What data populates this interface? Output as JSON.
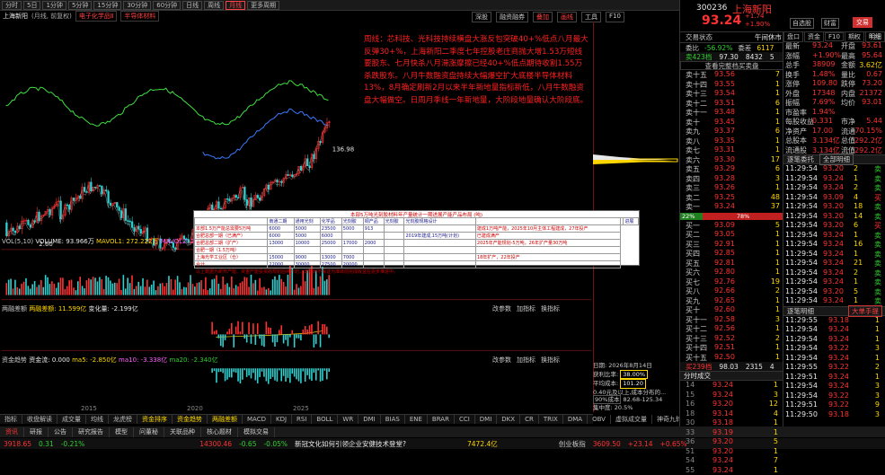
{
  "toolbar": {
    "periods": [
      "分时",
      "5日",
      "1分钟",
      "5分钟",
      "15分钟",
      "30分钟",
      "60分钟",
      "日线",
      "周线",
      "月线",
      "更多周期"
    ],
    "active_period": "月线",
    "right_buttons": [
      "深股",
      "融资融券",
      "叠加",
      "画线",
      "工具",
      "F10"
    ]
  },
  "titlebar": {
    "name": "上海新阳",
    "mode": "(月线, 前复权)",
    "tabs": [
      "电子化学品Ⅱ",
      "半导体材料"
    ]
  },
  "chart_tools": [
    "深股",
    "融资融券",
    "叠加",
    "画线",
    "工具"
  ],
  "price_labels": {
    "high": "136.98",
    "low": "2.60"
  },
  "annotation": "周线：芯科技、光科技持续横盘大涨反包突破40+%低点八月最大反弹30+%，上海新阳二季度七年控股老庄商抛大增1.53万短线要股东、七月快杀八月滞涨摩擦已经40+%低点期待收割1.55万杀跌股东。八月牛数融资盘持续大幅爆空扩大底楼半导体材料13%，8月确定刷新2月以来半年新地量指标新低，八月牛数融资盘大幅做空。日周月季线一年新地量，大阶段地量确认大阶段底。",
  "table_popup": {
    "title": "本部5万吨光刻胶材料年产量统计一期进展产能产品布局 (吨)",
    "headers": [
      "",
      "南通二期",
      "通用光刻",
      "化学品",
      "光刻胶",
      "铜产品",
      "光刻胶",
      "光刻胶规格设计",
      "",
      "",
      "进展"
    ],
    "rows": [
      [
        "本部1.5万产能总需要5万吨",
        "6000",
        "5000",
        "23500",
        "5000",
        "913",
        "",
        "",
        "建成1万吨产能，2025年10月主体工程建成，27年投产"
      ],
      [
        "合肥总部一期（已满产）",
        "6000",
        "5000",
        "6000",
        "",
        "",
        "",
        "2019年建成,15万吨(计划)",
        "已建成满产"
      ],
      [
        "合肥总部二期（扩产）",
        "13000",
        "10000",
        "25000",
        "17000",
        "2000",
        "",
        "",
        "2025年产能规划-5万吨，26年扩产量30万吨"
      ],
      [
        "合肥一期（1.5万吨）",
        "",
        "",
        "",
        "",
        "",
        "",
        "",
        ""
      ],
      [
        "上海光学工业区（仓）",
        "15000",
        "9000",
        "13000",
        "7000",
        "",
        "",
        "",
        "18年扩产，22年投产"
      ],
      [
        "合计",
        "22000",
        "30000",
        "27500",
        "20000",
        "",
        "",
        "",
        ""
      ]
    ],
    "note": "以上数据为新开产能、资金产能投资的规划后续计划，该规划不保证为准目前完成收益在逐步推进中。"
  },
  "indicators": {
    "vol": {
      "label": "VOL(5,10)",
      "volume": "VOLUME: 93.966万",
      "ma5": "MAVOL1: 272.222万",
      "ma10": "MAVOL2: 270.409万"
    },
    "margin": {
      "label": "两融差额",
      "value": "两融差额: 11.599亿",
      "change": "变化量: -2.199亿",
      "buttons": [
        "改参数",
        "加指标",
        "换指标"
      ]
    },
    "fund": {
      "label": "资金趋势",
      "value": "资金流: 0.000",
      "ma5": "ma5: -2.850亿",
      "ma10": "ma10: -3.338亿",
      "ma20": "ma20: -2.340亿",
      "buttons": [
        "改参数",
        "加指标",
        "换指标"
      ]
    }
  },
  "years": [
    "2015",
    "2020",
    "2025"
  ],
  "bottom_tabs": [
    "指标",
    "收盘解读",
    "成交量",
    "均线",
    "龙虎榜",
    "资金排序",
    "资金趋势",
    "两融差额",
    "MACD",
    "KDJ",
    "RSI",
    "BOLL",
    "WR",
    "DMI",
    "BIAS",
    "ENE",
    "BRAR",
    "CCI",
    "DMI",
    "DKX",
    "CR",
    "TRIX",
    "DMA",
    "OBV",
    "虚拟成交量",
    "神奇九转",
    "更多"
  ],
  "bottom_tabs2": [
    "资讯",
    "研报",
    "公告",
    "研究报告",
    "模型",
    "问董秘",
    "关联品种",
    "核心题材",
    "模拟交易"
  ],
  "ticker": {
    "index1": {
      "value": "3918.65",
      "change": "0.31",
      "pct": "-0.21%"
    },
    "index2": {
      "value": "14300.46",
      "change": "-0.65",
      "pct": "-0.05%"
    },
    "news": "新冠文化如何引领企业安健技术登堂?",
    "amount": "7472.4亿",
    "index3": {
      "name": "创业板指",
      "value": "3609.50",
      "change": "+23.14",
      "pct": "+0.65%"
    }
  },
  "quote": {
    "code": "300236",
    "name": "上海新阳",
    "price": "93.24",
    "change": "+1.74",
    "pct": "+1.90%",
    "menu": [
      "自选股",
      "财富",
      "交易"
    ],
    "trade_button": "交易",
    "ratio": {
      "label": "委比",
      "value": "-56.92%",
      "diff_label": "委差",
      "diff": "6117"
    },
    "order_book_header": {
      "label": "交易状态",
      "tag": "午间休市"
    },
    "sells": [
      {
        "n": "卖十五",
        "p": "93.56",
        "v": "7"
      },
      {
        "n": "卖十四",
        "p": "93.55",
        "v": "1"
      },
      {
        "n": "卖十三",
        "p": "93.54",
        "v": "1"
      },
      {
        "n": "卖十二",
        "p": "93.51",
        "v": "6"
      },
      {
        "n": "卖十一",
        "p": "93.48",
        "v": "1"
      },
      {
        "n": "卖十",
        "p": "93.45",
        "v": "1"
      },
      {
        "n": "卖九",
        "p": "93.37",
        "v": "6"
      },
      {
        "n": "卖八",
        "p": "93.35",
        "v": "1"
      },
      {
        "n": "卖七",
        "p": "93.31",
        "v": "1"
      },
      {
        "n": "卖六",
        "p": "93.30",
        "v": "17"
      },
      {
        "n": "卖五",
        "p": "93.29",
        "v": "6"
      },
      {
        "n": "卖四",
        "p": "93.28",
        "v": "3"
      },
      {
        "n": "卖三",
        "p": "93.26",
        "v": "1"
      },
      {
        "n": "卖二",
        "p": "93.25",
        "v": "48"
      },
      {
        "n": "卖一",
        "p": "93.24",
        "v": "37"
      }
    ],
    "buys": [
      {
        "n": "买一",
        "p": "93.09",
        "v": "5"
      },
      {
        "n": "买二",
        "p": "93.05",
        "v": "1"
      },
      {
        "n": "买三",
        "p": "92.91",
        "v": "1"
      },
      {
        "n": "买四",
        "p": "92.85",
        "v": "1"
      },
      {
        "n": "买五",
        "p": "92.81",
        "v": "1"
      },
      {
        "n": "买六",
        "p": "92.80",
        "v": "1"
      },
      {
        "n": "买七",
        "p": "92.76",
        "v": "19"
      },
      {
        "n": "买八",
        "p": "92.66",
        "v": "2"
      },
      {
        "n": "买九",
        "p": "92.65",
        "v": "1"
      },
      {
        "n": "买十",
        "p": "92.60",
        "v": "1"
      },
      {
        "n": "买十一",
        "p": "92.58",
        "v": "3"
      },
      {
        "n": "买十二",
        "p": "92.56",
        "v": "1"
      },
      {
        "n": "买十三",
        "p": "92.52",
        "v": "2"
      },
      {
        "n": "买十四",
        "p": "92.51",
        "v": "1"
      },
      {
        "n": "买十五",
        "p": "92.50",
        "v": "1"
      }
    ],
    "top": {
      "label": "卖423档",
      "price": "97.30",
      "vol": "8432",
      "count": "5"
    },
    "bottom": {
      "label": "买239档",
      "price": "98.03",
      "vol": "2315",
      "count": "4"
    },
    "link": "查看完整档买卖盘",
    "ratio_bar": {
      "left": "22%",
      "right": "78%"
    },
    "stats": [
      {
        "k": "最新",
        "v": "93.24",
        "k2": "开盘",
        "v2": "93.61"
      },
      {
        "k": "涨幅",
        "v": "+1.90%",
        "k2": "最高",
        "v2": "95.64"
      },
      {
        "k": "总手",
        "v": "38909",
        "k2": "金额",
        "v2": "3.62亿"
      },
      {
        "k": "换手",
        "v": "1.48%",
        "k2": "量比",
        "v2": "0.67"
      },
      {
        "k": "涨停",
        "v": "109.80",
        "k2": "跌停",
        "v2": "73.20"
      },
      {
        "k": "外盘",
        "v": "17348",
        "k2": "内盘",
        "v2": "21372"
      },
      {
        "k": "振幅",
        "v": "7.69%",
        "k2": "均价",
        "v2": "93.01"
      },
      {
        "k": "市盈率",
        "v": "1.94%",
        "k2": "",
        "v2": ""
      },
      {
        "k": "每股收益",
        "v": "0.331",
        "k2": "市净",
        "v2": "5.44"
      },
      {
        "k": "净资产",
        "v": "17.00",
        "k2": "流通",
        "v2": "70.15%"
      },
      {
        "k": "总股本",
        "v": "3.134亿",
        "k2": "总值",
        "v2": "292.2亿"
      },
      {
        "k": "流通股",
        "v": "3.134亿",
        "k2": "流值",
        "v2": "292.2亿"
      }
    ],
    "col_tabs": [
      "盘口",
      "资金",
      "F10",
      "期权",
      "明细"
    ]
  },
  "trades_title": {
    "label": "逐笔委托",
    "select": "全部明细"
  },
  "trades": [
    {
      "t": "11:29:54",
      "p": "93.20",
      "v": "2",
      "s": "卖"
    },
    {
      "t": "11:29:54",
      "p": "93.24",
      "v": "1",
      "s": "卖"
    },
    {
      "t": "11:29:54",
      "p": "93.24",
      "v": "2",
      "s": "卖"
    },
    {
      "t": "11:29:54",
      "p": "93.09",
      "v": "4",
      "s": "买"
    },
    {
      "t": "11:29:54",
      "p": "93.20",
      "v": "18",
      "s": "卖"
    },
    {
      "t": "11:29:54",
      "p": "93.20",
      "v": "14",
      "s": "卖"
    },
    {
      "t": "11:29:54",
      "p": "93.20",
      "v": "6",
      "s": "买"
    },
    {
      "t": "11:29:54",
      "p": "93.24",
      "v": "1",
      "s": "卖"
    },
    {
      "t": "11:29:54",
      "p": "93.24",
      "v": "16",
      "s": "卖"
    },
    {
      "t": "11:29:54",
      "p": "93.24",
      "v": "1",
      "s": "卖"
    },
    {
      "t": "11:29:54",
      "p": "93.24",
      "v": "21",
      "s": "卖"
    },
    {
      "t": "11:29:54",
      "p": "93.24",
      "v": "2",
      "s": "卖"
    },
    {
      "t": "11:29:54",
      "p": "93.24",
      "v": "1",
      "s": "卖"
    },
    {
      "t": "11:29:54",
      "p": "93.20",
      "v": "5",
      "s": "卖"
    },
    {
      "t": "11:29:54",
      "p": "93.24",
      "v": "1",
      "s": "卖"
    }
  ],
  "big_title": {
    "label": "逐笔明细",
    "select": "大单手提"
  },
  "big_trades": [
    {
      "t": "11:29:55",
      "p": "93.18",
      "v": "1"
    },
    {
      "t": "11:29:54",
      "p": "93.24",
      "v": "1"
    },
    {
      "t": "11:29:54",
      "p": "93.24",
      "v": "1"
    },
    {
      "t": "11:29:54",
      "p": "93.22",
      "v": "3"
    },
    {
      "t": "11:29:54",
      "p": "93.24",
      "v": "1"
    },
    {
      "t": "11:29:55",
      "p": "93.22",
      "v": "2"
    },
    {
      "t": "11:29:51",
      "p": "93.24",
      "v": "1"
    },
    {
      "t": "11:29:54",
      "p": "93.24",
      "v": "3"
    },
    {
      "t": "11:29:54",
      "p": "93.22",
      "v": "3"
    },
    {
      "t": "11:29:51",
      "p": "93.22",
      "v": "9"
    },
    {
      "t": "11:29:50",
      "p": "93.18",
      "v": "3"
    }
  ],
  "time_title": "分时成交",
  "time_trades": [
    {
      "t": "14",
      "p": "93.24",
      "v": "1"
    },
    {
      "t": "15",
      "p": "93.24",
      "v": "3"
    },
    {
      "t": "16",
      "p": "93.20",
      "v": "12"
    },
    {
      "t": "18",
      "p": "93.14",
      "v": "4"
    },
    {
      "t": "30",
      "p": "93.18",
      "v": "1"
    },
    {
      "t": "33",
      "p": "93.19",
      "v": "1"
    },
    {
      "t": "36",
      "p": "93.20",
      "v": "5"
    },
    {
      "t": "51",
      "p": "93.20",
      "v": "1"
    },
    {
      "t": "54",
      "p": "93.24",
      "v": "7"
    },
    {
      "t": "55",
      "p": "93.24",
      "v": "1"
    }
  ],
  "chip": {
    "date": "日期: 2026年8月14日",
    "profit_label": "获利比率:",
    "profit": "38.00%",
    "avg_label": "平均成本:",
    "avg": "101.20",
    "cost_line": "0.40元及以上,成本分布的...",
    "mode": "90%成本",
    "range": "82.68-125.34",
    "conc": "集中度: 20.5%"
  }
}
